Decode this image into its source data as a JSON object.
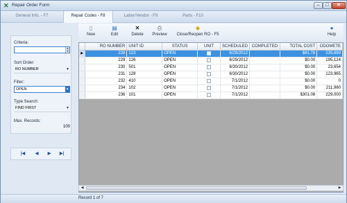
{
  "window": {
    "title": "Repair Order Form",
    "buttons": {
      "minimize": "–",
      "maximize": "□",
      "close": "✕"
    }
  },
  "tabs": [
    {
      "label": "General Info. - F7",
      "active": false
    },
    {
      "label": "Repair Codes - F8",
      "active": true
    },
    {
      "label": "Labor/Vendor - F9",
      "active": false
    },
    {
      "label": "Parts - F10",
      "active": false
    }
  ],
  "filters": {
    "criteria_label": "Criteria:",
    "criteria_value": "",
    "sort_order_label": "Sort Order:",
    "sort_order_value": "RO NUMBER",
    "filter_label": "Filter:",
    "filter_value": "OPEN",
    "type_search_label": "Type Search:",
    "type_search_value": "FIND FIRST",
    "max_records_label": "Max. Records:",
    "max_records_value": "100"
  },
  "nav": {
    "first": "|◀",
    "prev": "◀",
    "next": "▶",
    "last": "▶|"
  },
  "toolbar": {
    "new": "New",
    "edit": "Edit",
    "delete": "Delete",
    "preview": "Preview",
    "close_reopen": "Close/Reopen RO - F5",
    "help": "Help"
  },
  "grid": {
    "columns": [
      "RO NUMBER",
      "UNIT ID",
      "STATUS",
      "UNIT",
      "SCHEDULED",
      "COMPLETED",
      "TOTAL COST",
      "ODOMETE"
    ],
    "rows": [
      {
        "ro": "228",
        "unit_id": "123",
        "status": "OPEN",
        "scheduled": "6/29/2012",
        "completed": "",
        "total_cost": "$81.78",
        "odometer": "235,689"
      },
      {
        "ro": "229",
        "unit_id": "126",
        "status": "OPEN",
        "scheduled": "6/29/2012",
        "completed": "",
        "total_cost": "$0.00",
        "odometer": "195,124"
      },
      {
        "ro": "230",
        "unit_id": "501",
        "status": "OPEN",
        "scheduled": "6/30/2012",
        "completed": "",
        "total_cost": "$0.00",
        "odometer": "23,654"
      },
      {
        "ro": "231",
        "unit_id": "128",
        "status": "OPEN",
        "scheduled": "6/30/2012",
        "completed": "",
        "total_cost": "$0.00",
        "odometer": "123,965"
      },
      {
        "ro": "232",
        "unit_id": "410",
        "status": "OPEN",
        "scheduled": "7/1/2012",
        "completed": "",
        "total_cost": "$0.00",
        "odometer": "0"
      },
      {
        "ro": "234",
        "unit_id": "102",
        "status": "OPEN",
        "scheduled": "7/1/2012",
        "completed": "",
        "total_cost": "$0.00",
        "odometer": "211,960"
      },
      {
        "ro": "236",
        "unit_id": "101",
        "status": "OPEN",
        "scheduled": "7/1/2012",
        "completed": "",
        "total_cost": "$301.08",
        "odometer": "229,000"
      }
    ],
    "selected_row_indicator": "▶"
  },
  "status": {
    "text": "Record 1 of 7"
  },
  "colors": {
    "selection": "#3c92e0",
    "grid_empty": "#ababab",
    "accent": "#2e6ec4"
  }
}
